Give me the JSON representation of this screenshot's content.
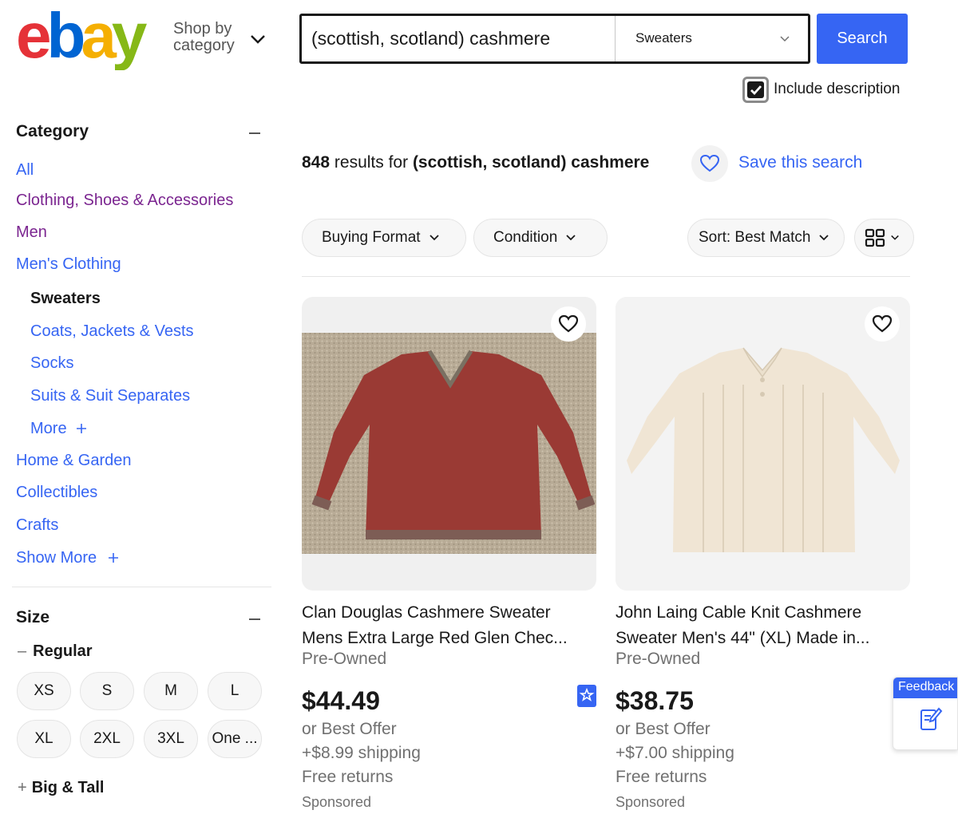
{
  "header": {
    "logo_letters": [
      "e",
      "b",
      "a",
      "y"
    ],
    "shop_by_line1": "Shop by",
    "shop_by_line2": "category",
    "search_value": "(scottish, scotland) cashmere",
    "category_select": "Sweaters",
    "search_button": "Search",
    "include_description": "Include description",
    "include_description_checked": true
  },
  "sidebar": {
    "category_heading": "Category",
    "categories": [
      {
        "label": "All"
      },
      {
        "label": "Clothing, Shoes & Accessories"
      },
      {
        "label": "Men"
      },
      {
        "label": "Men's Clothing"
      },
      {
        "label": "Sweaters"
      },
      {
        "label": "Coats, Jackets & Vests"
      },
      {
        "label": "Socks"
      },
      {
        "label": "Suits & Suit Separates"
      },
      {
        "label": "More"
      },
      {
        "label": "Home & Garden"
      },
      {
        "label": "Collectibles"
      },
      {
        "label": "Crafts"
      },
      {
        "label": "Show More"
      }
    ],
    "size_heading": "Size",
    "regular_label": "Regular",
    "sizes": [
      "XS",
      "S",
      "M",
      "L",
      "XL",
      "2XL",
      "3XL",
      "One ..."
    ],
    "big_tall_label": "Big & Tall"
  },
  "results": {
    "count": "848",
    "results_for": "results for",
    "query": "(scottish, scotland) cashmere",
    "save_search": "Save this search",
    "filters": [
      "Buying Format",
      "Condition"
    ],
    "sort": "Sort: Best Match",
    "items": [
      {
        "title_line1": "Clan Douglas Cashmere Sweater",
        "title_line2": "Mens Extra Large Red Glen Chec...",
        "condition": "Pre-Owned",
        "price": "$44.49",
        "offer": "or Best Offer",
        "shipping": "+$8.99 shipping",
        "returns": "Free returns",
        "sponsored": "Sponsored"
      },
      {
        "title_line1": "John Laing Cable Knit Cashmere",
        "title_line2": "Sweater Men's 44\" (XL) Made in...",
        "condition": "Pre-Owned",
        "price": "$38.75",
        "offer": "or Best Offer",
        "shipping": "+$7.00 shipping",
        "returns": "Free returns",
        "sponsored": "Sponsored"
      }
    ]
  },
  "feedback": {
    "label": "Feedback"
  },
  "colors": {
    "ebay_red": "#e53238",
    "ebay_blue": "#0064d2",
    "ebay_yellow": "#f5af02",
    "ebay_green": "#86b817",
    "link_blue": "#3665f3",
    "visited_purple": "#7b2590"
  }
}
